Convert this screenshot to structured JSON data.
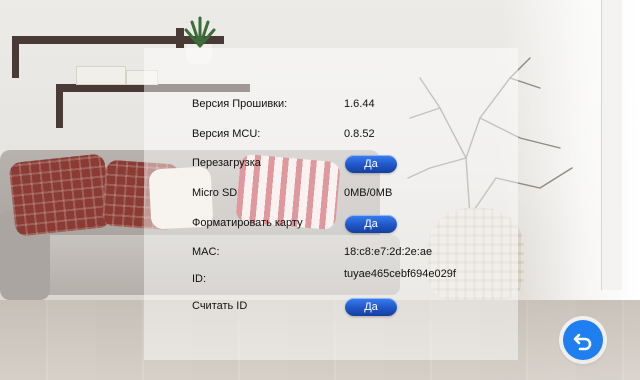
{
  "settings": {
    "firmware_version": {
      "label": "Версия Прошивки:",
      "value": "1.6.44"
    },
    "mcu_version": {
      "label": "Версия MCU:",
      "value": "0.8.52"
    },
    "reboot": {
      "label": "Перезагрузка",
      "button": "Да"
    },
    "micro_sd": {
      "label": "Micro SD",
      "value": "0MB/0MB"
    },
    "format_card": {
      "label": "Форматировать карту",
      "button": "Да"
    },
    "mac": {
      "label": "MAC:",
      "value": "18:c8:e7:2d:2e:ae"
    },
    "id": {
      "label": "ID:",
      "value": "tuyae465cebf694e029f"
    },
    "read_id": {
      "label": "Считать ID",
      "button": "Да"
    }
  },
  "back_button": {
    "icon": "return-arrow-icon"
  },
  "colors": {
    "button_blue": "#1f56c8",
    "back_blue": "#1f7ef0"
  }
}
